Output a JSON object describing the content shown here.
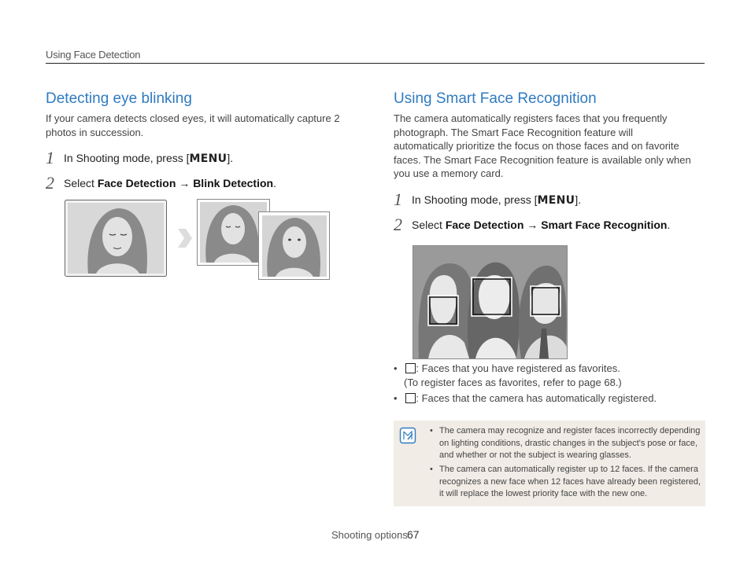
{
  "header": {
    "section_label": "Using Face Detection"
  },
  "left": {
    "title": "Detecting eye blinking",
    "intro_line1": "If your camera detects closed eyes, it will automatically capture 2",
    "intro_line2": "photos in succession.",
    "step1": {
      "num": "1",
      "text": "In Shooting mode, press [",
      "key": "MENU",
      "end": "]."
    },
    "step2": {
      "num": "2",
      "prefix": "Select ",
      "item1": "Face Detection",
      "arrow": " → ",
      "item2": "Blink Detection",
      "end": "."
    }
  },
  "right": {
    "title": "Using Smart Face Recognition",
    "intro_lines": [
      "The camera automatically registers faces that you frequently",
      "photograph. The Smart Face Recognition feature will",
      "automatically prioritize the focus on those faces and on favorite",
      "faces. The Smart Face Recognition feature is available only when",
      "you use a memory card."
    ],
    "step1": {
      "num": "1",
      "text": "In Shooting mode, press [",
      "key": "MENU",
      "end": "]."
    },
    "step2": {
      "num": "2",
      "prefix": "Select ",
      "item1": "Face Detection",
      "arrow": " → ",
      "item2": "Smart Face Recognition",
      "end": "."
    },
    "bullets": [
      {
        "line1": ": Faces that you have registered as favorites.",
        "line2": "(To register faces as favorites, refer to page 68.)"
      },
      {
        "line1": ": Faces that the camera has automatically registered."
      }
    ]
  },
  "note": {
    "icon": "note-pencil-icon",
    "items": [
      [
        "The camera may recognize and register faces incorrectly depending",
        "on lighting conditions, drastic changes in the subject's pose or face,",
        "and whether or not the subject is wearing glasses."
      ],
      [
        "The camera can automatically register up to 12 faces. If the camera",
        "recognizes a new face when 12 faces have already been registered,",
        "it will replace the lowest priority face with the new one."
      ]
    ]
  },
  "footer": {
    "label": "Shooting options",
    "page": "67"
  },
  "colors": {
    "accent": "#2f7bc0",
    "note_bg": "#f1ece6",
    "illustration_gray": "#999999"
  }
}
